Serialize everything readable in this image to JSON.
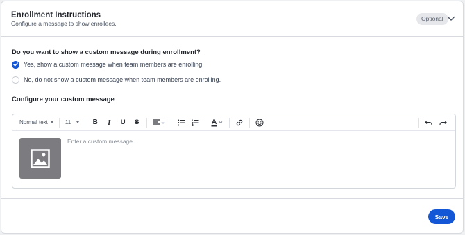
{
  "header": {
    "title": "Enrollment Instructions",
    "subtitle": "Configure a message to show enrollees.",
    "badge": "Optional",
    "toggle_icon": "chevron-down-icon"
  },
  "question": {
    "text": "Do you want to show a custom message during enrollment?",
    "options": [
      {
        "label": "Yes, show a custom message when team members are enrolling.",
        "checked": true
      },
      {
        "label": "No, do not show a custom message when team members are enrolling.",
        "checked": false
      }
    ]
  },
  "editor": {
    "section_label": "Configure your custom message",
    "text_style": "Normal text",
    "font_size": "11",
    "placeholder": "Enter a custom message...",
    "toolbar_icons": [
      "bold-icon",
      "italic-icon",
      "underline-icon",
      "strikethrough-icon",
      "align-icon",
      "bulleted-list-icon",
      "numbered-list-icon",
      "text-color-icon",
      "link-icon",
      "emoji-icon",
      "undo-icon",
      "redo-icon"
    ],
    "image_icon": "image-icon"
  },
  "footer": {
    "save_label": "Save"
  },
  "colors": {
    "accent": "#1457d6",
    "badge_bg": "#e5e7eb",
    "border": "#d7dbe0",
    "image_placeholder": "#7c7c80"
  }
}
